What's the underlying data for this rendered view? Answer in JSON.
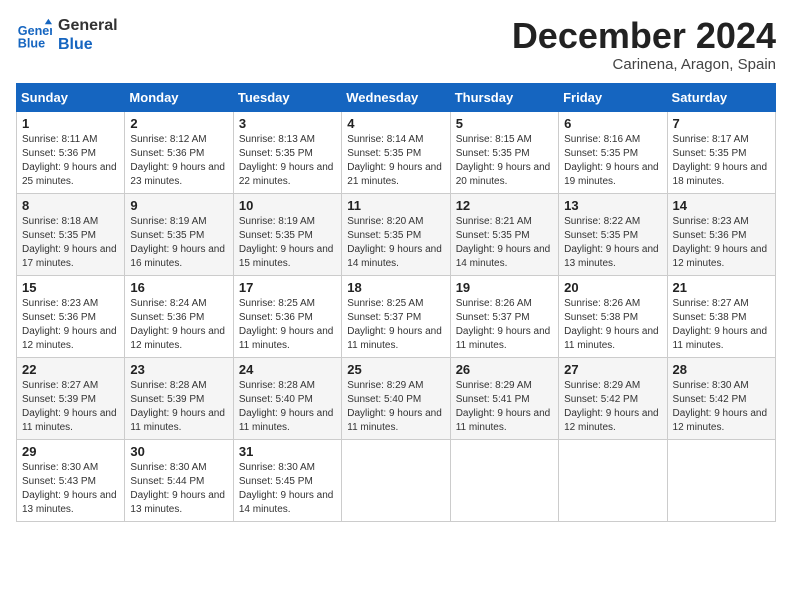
{
  "header": {
    "logo_line1": "General",
    "logo_line2": "Blue",
    "month_title": "December 2024",
    "subtitle": "Carinena, Aragon, Spain"
  },
  "weekdays": [
    "Sunday",
    "Monday",
    "Tuesday",
    "Wednesday",
    "Thursday",
    "Friday",
    "Saturday"
  ],
  "weeks": [
    [
      {
        "day": "1",
        "sunrise": "8:11 AM",
        "sunset": "5:36 PM",
        "daylight": "9 hours and 25 minutes."
      },
      {
        "day": "2",
        "sunrise": "8:12 AM",
        "sunset": "5:36 PM",
        "daylight": "9 hours and 23 minutes."
      },
      {
        "day": "3",
        "sunrise": "8:13 AM",
        "sunset": "5:35 PM",
        "daylight": "9 hours and 22 minutes."
      },
      {
        "day": "4",
        "sunrise": "8:14 AM",
        "sunset": "5:35 PM",
        "daylight": "9 hours and 21 minutes."
      },
      {
        "day": "5",
        "sunrise": "8:15 AM",
        "sunset": "5:35 PM",
        "daylight": "9 hours and 20 minutes."
      },
      {
        "day": "6",
        "sunrise": "8:16 AM",
        "sunset": "5:35 PM",
        "daylight": "9 hours and 19 minutes."
      },
      {
        "day": "7",
        "sunrise": "8:17 AM",
        "sunset": "5:35 PM",
        "daylight": "9 hours and 18 minutes."
      }
    ],
    [
      {
        "day": "8",
        "sunrise": "8:18 AM",
        "sunset": "5:35 PM",
        "daylight": "9 hours and 17 minutes."
      },
      {
        "day": "9",
        "sunrise": "8:19 AM",
        "sunset": "5:35 PM",
        "daylight": "9 hours and 16 minutes."
      },
      {
        "day": "10",
        "sunrise": "8:19 AM",
        "sunset": "5:35 PM",
        "daylight": "9 hours and 15 minutes."
      },
      {
        "day": "11",
        "sunrise": "8:20 AM",
        "sunset": "5:35 PM",
        "daylight": "9 hours and 14 minutes."
      },
      {
        "day": "12",
        "sunrise": "8:21 AM",
        "sunset": "5:35 PM",
        "daylight": "9 hours and 14 minutes."
      },
      {
        "day": "13",
        "sunrise": "8:22 AM",
        "sunset": "5:35 PM",
        "daylight": "9 hours and 13 minutes."
      },
      {
        "day": "14",
        "sunrise": "8:23 AM",
        "sunset": "5:36 PM",
        "daylight": "9 hours and 12 minutes."
      }
    ],
    [
      {
        "day": "15",
        "sunrise": "8:23 AM",
        "sunset": "5:36 PM",
        "daylight": "9 hours and 12 minutes."
      },
      {
        "day": "16",
        "sunrise": "8:24 AM",
        "sunset": "5:36 PM",
        "daylight": "9 hours and 12 minutes."
      },
      {
        "day": "17",
        "sunrise": "8:25 AM",
        "sunset": "5:36 PM",
        "daylight": "9 hours and 11 minutes."
      },
      {
        "day": "18",
        "sunrise": "8:25 AM",
        "sunset": "5:37 PM",
        "daylight": "9 hours and 11 minutes."
      },
      {
        "day": "19",
        "sunrise": "8:26 AM",
        "sunset": "5:37 PM",
        "daylight": "9 hours and 11 minutes."
      },
      {
        "day": "20",
        "sunrise": "8:26 AM",
        "sunset": "5:38 PM",
        "daylight": "9 hours and 11 minutes."
      },
      {
        "day": "21",
        "sunrise": "8:27 AM",
        "sunset": "5:38 PM",
        "daylight": "9 hours and 11 minutes."
      }
    ],
    [
      {
        "day": "22",
        "sunrise": "8:27 AM",
        "sunset": "5:39 PM",
        "daylight": "9 hours and 11 minutes."
      },
      {
        "day": "23",
        "sunrise": "8:28 AM",
        "sunset": "5:39 PM",
        "daylight": "9 hours and 11 minutes."
      },
      {
        "day": "24",
        "sunrise": "8:28 AM",
        "sunset": "5:40 PM",
        "daylight": "9 hours and 11 minutes."
      },
      {
        "day": "25",
        "sunrise": "8:29 AM",
        "sunset": "5:40 PM",
        "daylight": "9 hours and 11 minutes."
      },
      {
        "day": "26",
        "sunrise": "8:29 AM",
        "sunset": "5:41 PM",
        "daylight": "9 hours and 11 minutes."
      },
      {
        "day": "27",
        "sunrise": "8:29 AM",
        "sunset": "5:42 PM",
        "daylight": "9 hours and 12 minutes."
      },
      {
        "day": "28",
        "sunrise": "8:30 AM",
        "sunset": "5:42 PM",
        "daylight": "9 hours and 12 minutes."
      }
    ],
    [
      {
        "day": "29",
        "sunrise": "8:30 AM",
        "sunset": "5:43 PM",
        "daylight": "9 hours and 13 minutes."
      },
      {
        "day": "30",
        "sunrise": "8:30 AM",
        "sunset": "5:44 PM",
        "daylight": "9 hours and 13 minutes."
      },
      {
        "day": "31",
        "sunrise": "8:30 AM",
        "sunset": "5:45 PM",
        "daylight": "9 hours and 14 minutes."
      },
      null,
      null,
      null,
      null
    ]
  ]
}
